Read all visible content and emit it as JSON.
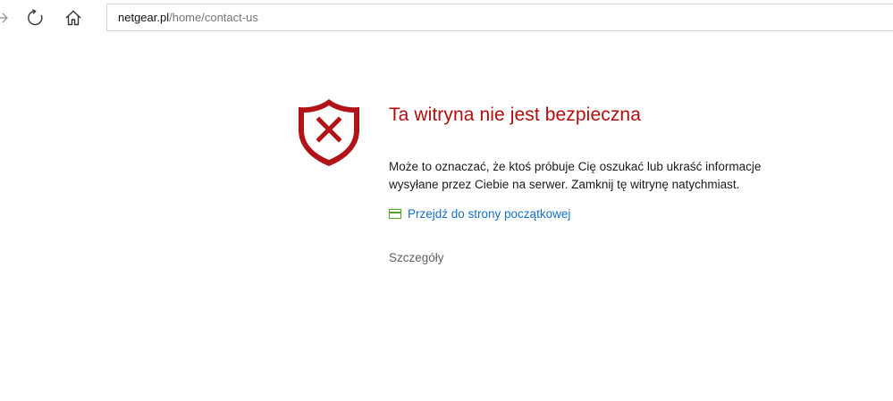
{
  "browser": {
    "address_host": "netgear.pl",
    "address_path": "/home/contact-us",
    "icons": {
      "forward": "forward-arrow-icon",
      "refresh": "refresh-icon",
      "home": "home-icon"
    }
  },
  "warning": {
    "icon": "shield-x-icon",
    "title": "Ta witryna nie jest bezpieczna",
    "message_line1": "Może to oznaczać, że ktoś próbuje Cię oszukać lub ukraść informacje",
    "message_line2": "wysyłane przez Ciebie na serwer. Zamknij tę witrynę natychmiast.",
    "home_link_label": "Przejdź do strony początkowej",
    "home_link_icon": "page-icon",
    "details_label": "Szczegóły"
  },
  "colors": {
    "title_red": "#b00e0e",
    "shield_red": "#b11417",
    "link_blue": "#1a6fc4",
    "icon_green": "#5a9e2a"
  }
}
